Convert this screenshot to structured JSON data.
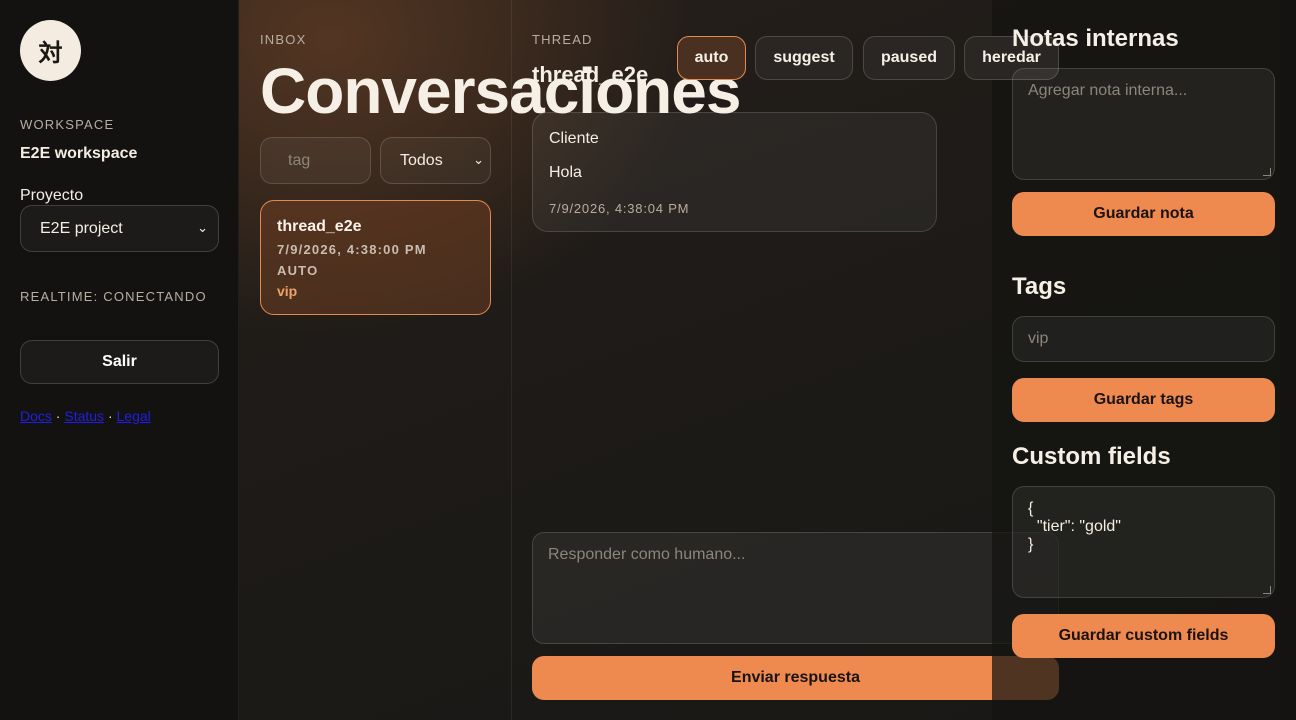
{
  "sidebar": {
    "logo_glyph": "対",
    "workspace_eyebrow": "WORKSPACE",
    "workspace_name": "E2E workspace",
    "project_label": "Proyecto",
    "project_value": "E2E project",
    "realtime_status": "REALTIME: CONECTANDO",
    "logout_label": "Salir",
    "links": {
      "docs": "Docs",
      "status": "Status",
      "legal": "Legal",
      "separator": "·"
    }
  },
  "inbox": {
    "eyebrow": "INBOX",
    "title": "Conversaciones",
    "tag_placeholder": "tag",
    "filter_value": "Todos",
    "threads": [
      {
        "id": "thread_e2e",
        "timestamp": "7/9/2026, 4:38:00 PM",
        "mode": "AUTO",
        "tag": "vip"
      }
    ]
  },
  "thread": {
    "eyebrow": "THREAD",
    "title": "thread_e2e",
    "modes": [
      "auto",
      "suggest",
      "paused",
      "heredar"
    ],
    "active_mode": "auto",
    "messages": [
      {
        "author": "Cliente",
        "text": "Hola",
        "timestamp": "7/9/2026, 4:38:04 PM"
      }
    ],
    "reply_placeholder": "Responder como humano...",
    "send_label": "Enviar respuesta"
  },
  "panel": {
    "notes_title": "Notas internas",
    "notes_placeholder": "Agregar nota interna...",
    "save_note_label": "Guardar nota",
    "tags_title": "Tags",
    "tags_value": "vip",
    "save_tags_label": "Guardar tags",
    "custom_fields_title": "Custom fields",
    "custom_fields_value": "{\n  \"tier\": \"gold\"\n}",
    "save_custom_fields_label": "Guardar custom fields"
  },
  "colors": {
    "accent": "#ee8a50",
    "link": "#1f1fe8",
    "background": "#1e1b18"
  }
}
